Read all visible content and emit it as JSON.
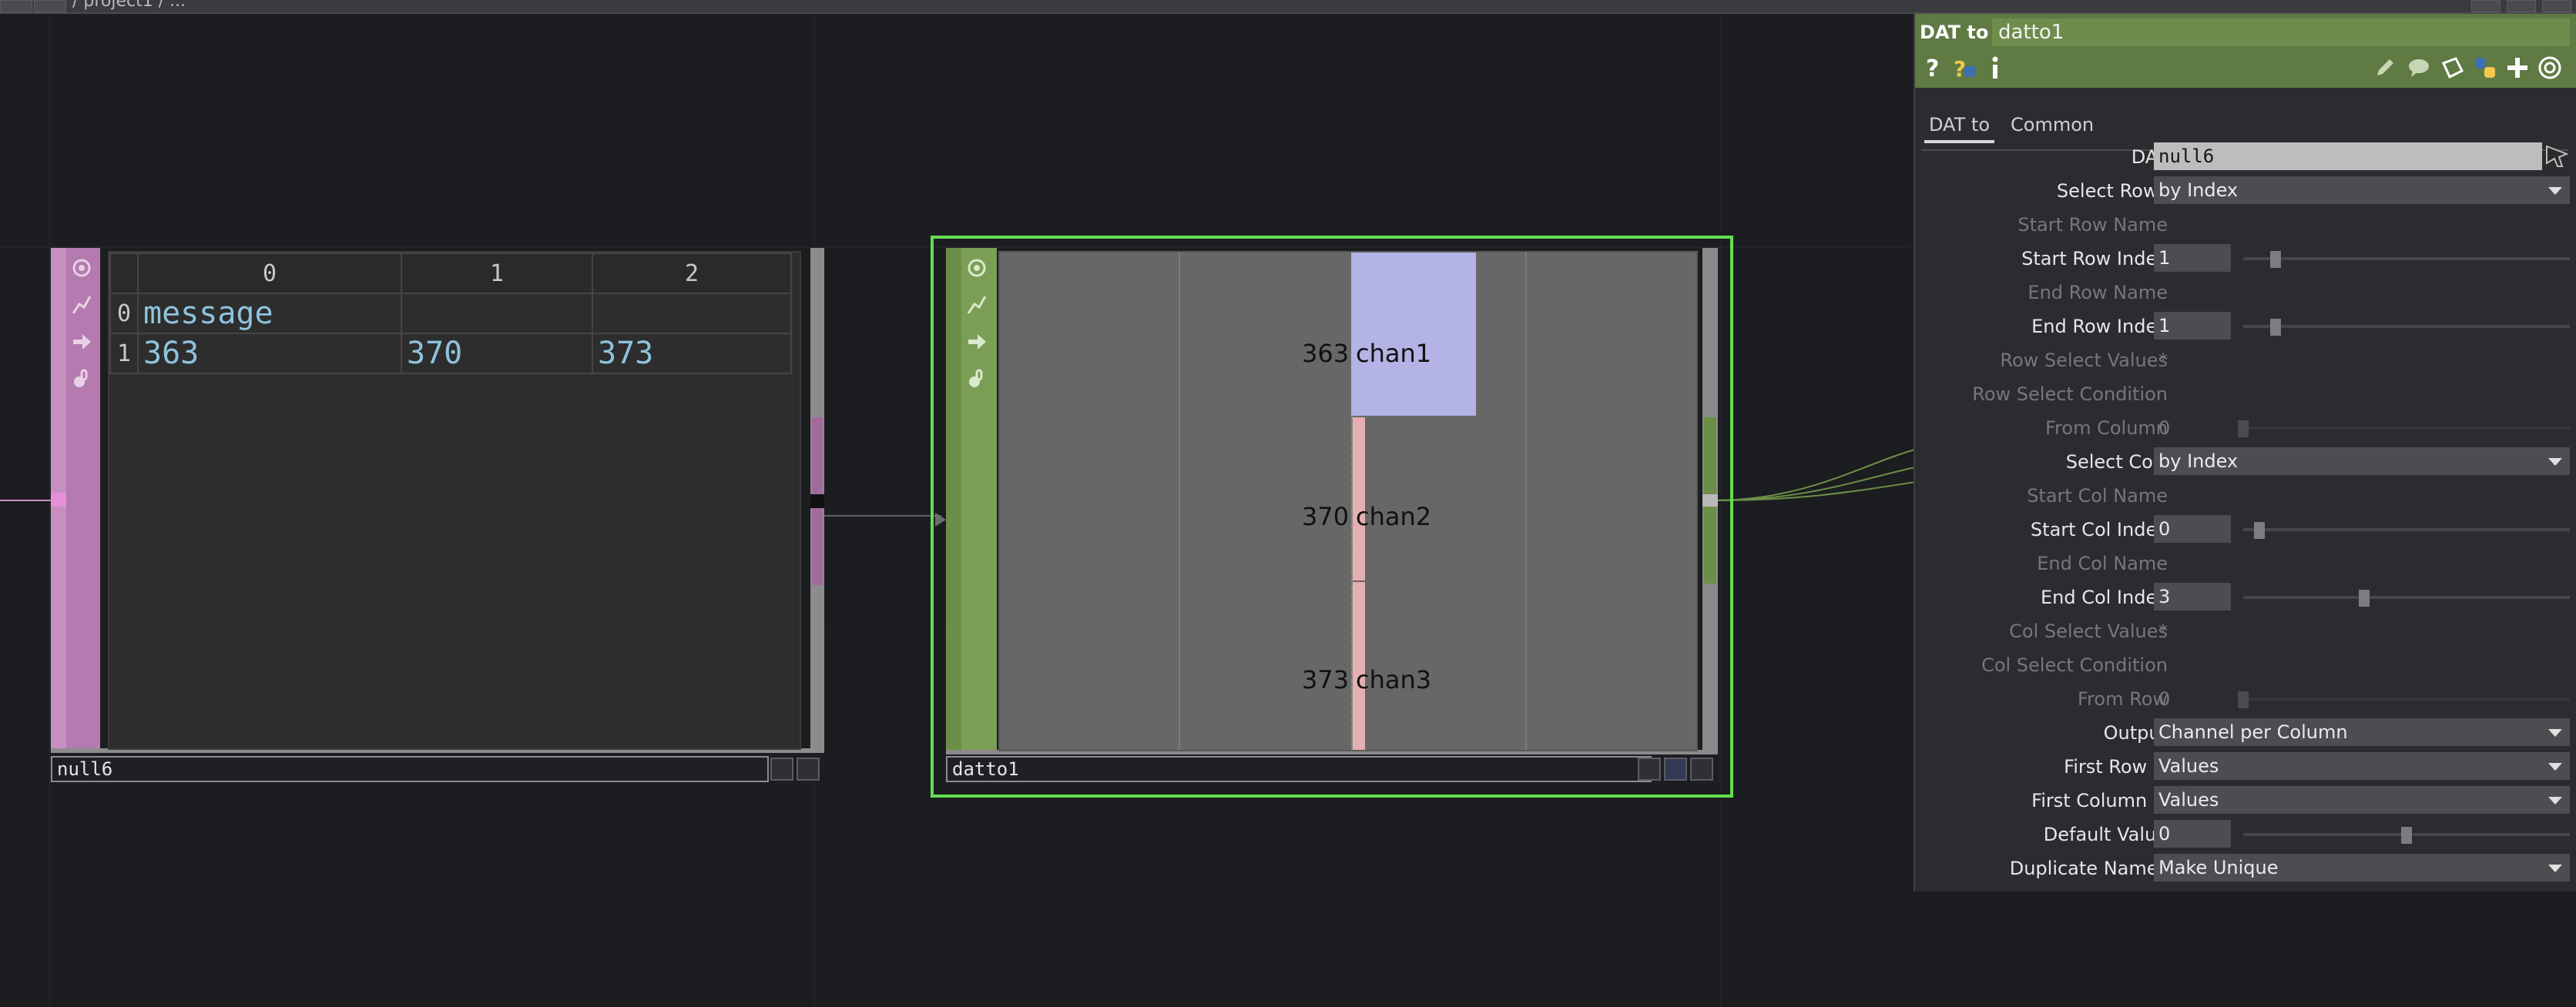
{
  "topbar": {
    "path": "/ project1 / ..."
  },
  "nodes": {
    "null6": {
      "name": "null6",
      "table": {
        "col_headers": [
          "0",
          "1",
          "2"
        ],
        "rows": [
          {
            "index": "0",
            "cells": [
              "message",
              "",
              ""
            ]
          },
          {
            "index": "1",
            "cells": [
              "363",
              "370",
              "373"
            ]
          }
        ]
      }
    },
    "datto1": {
      "name": "datto1",
      "channels": [
        {
          "value": "363",
          "name": "chan1"
        },
        {
          "value": "370",
          "name": "chan2"
        },
        {
          "value": "373",
          "name": "chan3"
        }
      ]
    }
  },
  "panel": {
    "op_type": "DAT to",
    "op_name": "datto1",
    "tabs": [
      "DAT to",
      "Common"
    ],
    "active_tab": "DAT to",
    "params": [
      {
        "label": "DAT",
        "kind": "field-light",
        "value": "null6"
      },
      {
        "label": "Select Rows",
        "kind": "menu",
        "value": "by Index"
      },
      {
        "label": "Start Row Name",
        "kind": "dim",
        "value": ""
      },
      {
        "label": "Start Row Index",
        "kind": "slider",
        "value": "1",
        "level": 0.1
      },
      {
        "label": "End Row  Name",
        "kind": "dim",
        "value": ""
      },
      {
        "label": "End Row Index",
        "kind": "slider",
        "value": "1",
        "level": 0.1
      },
      {
        "label": "Row Select Values",
        "kind": "dim",
        "value": "*"
      },
      {
        "label": "Row Select Condition",
        "kind": "dim",
        "value": ""
      },
      {
        "label": "From Column",
        "kind": "slider-dim",
        "value": "0",
        "level": 0.0
      },
      {
        "label": "Select Cols",
        "kind": "menu",
        "value": "by Index"
      },
      {
        "label": "Start Col Name",
        "kind": "dim",
        "value": ""
      },
      {
        "label": "Start Col Index",
        "kind": "slider",
        "value": "0",
        "level": 0.05
      },
      {
        "label": "End Col Name",
        "kind": "dim",
        "value": ""
      },
      {
        "label": "End Col Index",
        "kind": "slider",
        "value": "3",
        "level": 0.37
      },
      {
        "label": "Col Select Values",
        "kind": "dim",
        "value": "*"
      },
      {
        "label": "Col Select Condition",
        "kind": "dim",
        "value": ""
      },
      {
        "label": "From Row",
        "kind": "slider-dim",
        "value": "0",
        "level": 0.0
      },
      {
        "label": "Output",
        "kind": "menu",
        "value": "Channel per Column"
      },
      {
        "label": "First Row is",
        "kind": "menu",
        "value": "Values"
      },
      {
        "label": "First Column is",
        "kind": "menu",
        "value": "Values"
      },
      {
        "label": "Default Value",
        "kind": "slider",
        "value": "0",
        "level": 0.5
      },
      {
        "label": "Duplicate Names",
        "kind": "menu",
        "value": "Make Unique"
      }
    ]
  },
  "colors": {
    "accent_green": "#5f7a43",
    "dat_purple": "#c78fbf",
    "chop_green": "#6c8f48",
    "selected_outline": "#62e04f",
    "chan1_bar": "#b3b3e6",
    "chan2_bar": "#e6b0b0"
  }
}
